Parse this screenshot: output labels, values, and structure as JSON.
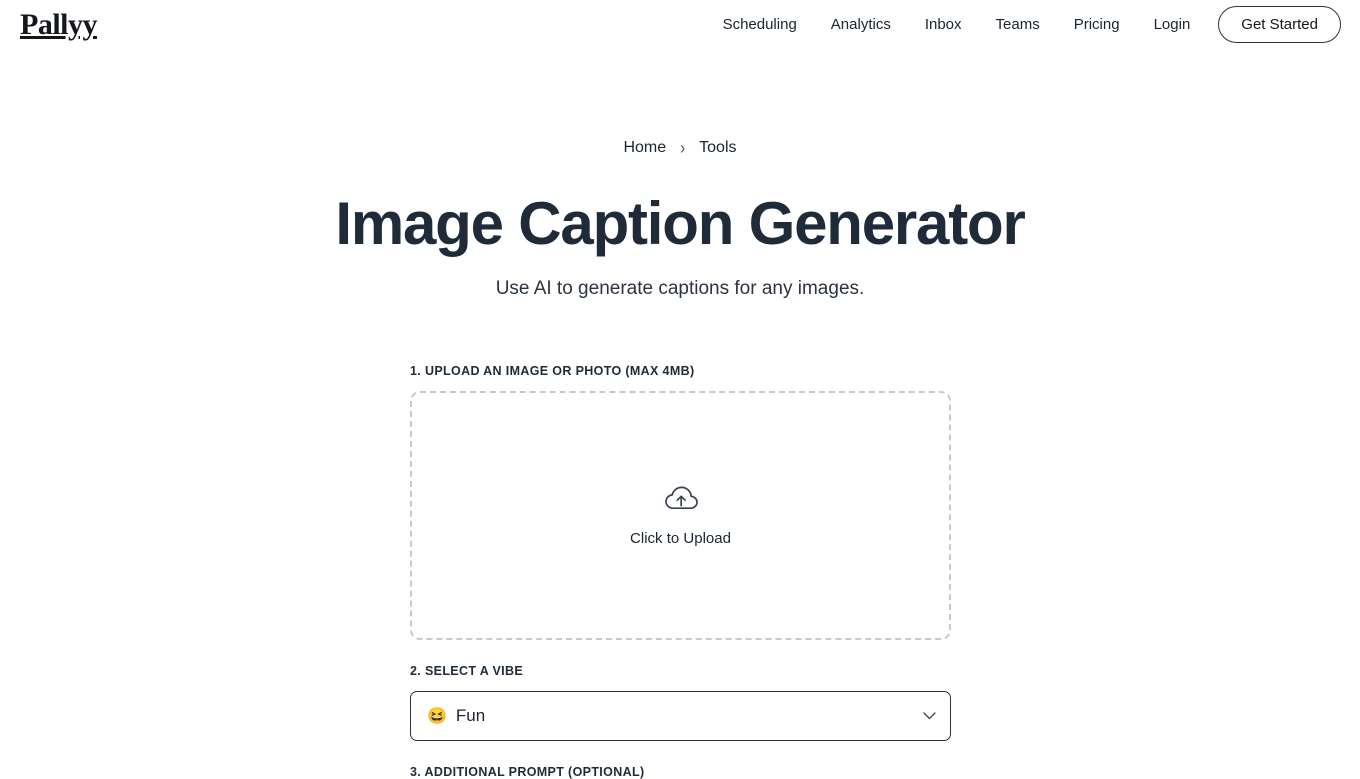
{
  "header": {
    "logo": "Pallyy",
    "nav": [
      {
        "label": "Scheduling"
      },
      {
        "label": "Analytics"
      },
      {
        "label": "Inbox"
      },
      {
        "label": "Teams"
      },
      {
        "label": "Pricing"
      },
      {
        "label": "Login"
      }
    ],
    "cta": "Get Started"
  },
  "breadcrumb": {
    "home": "Home",
    "separator": "›",
    "current": "Tools"
  },
  "hero": {
    "title": "Image Caption Generator",
    "subtitle": "Use AI to generate captions for any images."
  },
  "form": {
    "upload": {
      "label": "1. Upload an image or photo (max 4MB)",
      "icon": "cloud-upload-icon",
      "cta": "Click to Upload"
    },
    "vibe": {
      "label": "2. Select a vibe",
      "emoji": "😆",
      "value": "Fun",
      "chevron": "chevron-down-icon"
    },
    "prompt": {
      "label": "3. Additional prompt (optional)"
    }
  },
  "colors": {
    "text_dark": "#1c2430",
    "heading": "#1f2b38",
    "border": "#2b3440",
    "dashed_border": "#c5cad2"
  }
}
